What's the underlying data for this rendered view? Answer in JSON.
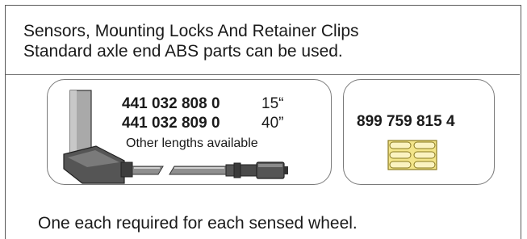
{
  "header": {
    "line1": "Sensors, Mounting Locks And Retainer Clips",
    "line2": "Standard axle end ABS parts can be used."
  },
  "sensor_panel": {
    "part_1": {
      "number": "441 032 808 0",
      "length": "15“"
    },
    "part_2": {
      "number": "441 032 809 0",
      "length": "40”"
    },
    "note": "Other lengths available"
  },
  "clip_panel": {
    "part_number": "899 759 815 4"
  },
  "footer": {
    "text": "One each required for each sensed wheel."
  },
  "colors": {
    "sensor_body": "#a9a9a9",
    "sensor_dark": "#4d4d4d",
    "clip_fill": "#f3e58a",
    "clip_stroke": "#8a7a20",
    "border": "#6a6a6a"
  }
}
